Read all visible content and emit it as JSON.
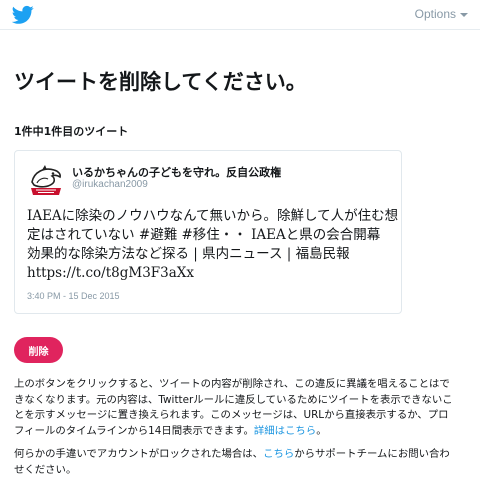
{
  "header": {
    "logo_icon": "twitter-bird-icon",
    "options_label": "Options"
  },
  "main": {
    "title": "ツイートを削除してください。",
    "count_label": "1件中1件目のツイート"
  },
  "tweet": {
    "display_name": "いるかちゃんの子どもを守れ。反自公政権",
    "handle": "@irukachan2009",
    "text_lines": [
      "IAEAに除染のノウハウなんて無いから。除鮮して人が住む想",
      "定はされていない #避難 #移住・・ IAEAと県の会合開幕",
      "効果的な除染方法など探る | 県内ニュース | 福島民報",
      "https://t.co/t8gM3F3aXx"
    ],
    "timestamp": "3:40 PM - 15 Dec 2015"
  },
  "actions": {
    "delete_label": "削除",
    "delete_color": "#e0245e"
  },
  "notice": {
    "line1": "上のボタンをクリックすると、ツイートの内容が削除され、この違反に異議を唱えることはで",
    "line2": "きなくなります。元の内容は、Twitterルールに違反しているためにツイートを表示できないこ",
    "line3": "とを示すメッセージに置き換えられます。このメッセージは、URLから直接表示するか、プロ",
    "line4_text": "フィールのタイムラインから14日間表示できます。",
    "line4_link": "詳細はこちら",
    "line4_end": "。"
  },
  "support": {
    "text_before": "何らかの手違いでアカウントがロックされた場合は、",
    "link": "こちら",
    "text_after": "からサポートチームにお問い合わ",
    "line2": "せください。"
  },
  "colors": {
    "link": "#1b95e0",
    "brand": "#1da1f2"
  }
}
